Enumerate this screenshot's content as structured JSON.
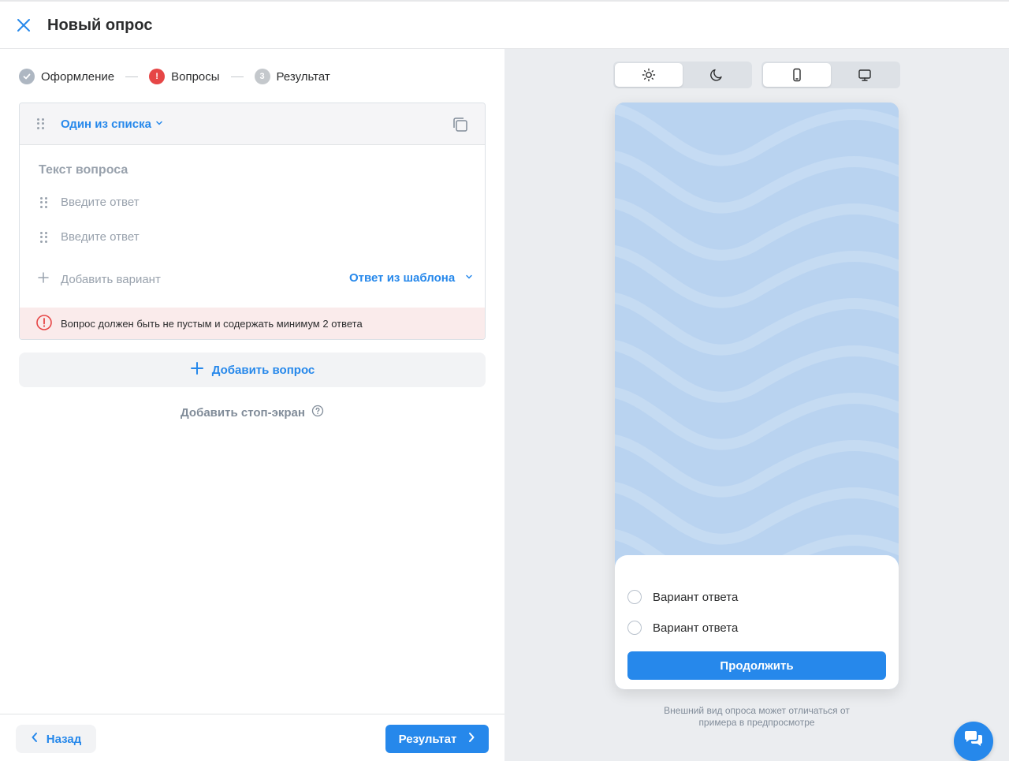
{
  "header": {
    "title": "Новый опрос"
  },
  "steps": [
    {
      "label": "Оформление",
      "state": "done"
    },
    {
      "label": "Вопросы",
      "state": "error",
      "marker": "!"
    },
    {
      "label": "Результат",
      "state": "pending",
      "marker": "3"
    }
  ],
  "question": {
    "type_label": "Один из списка",
    "text_placeholder": "Текст вопроса",
    "answers": [
      {
        "placeholder": "Введите ответ"
      },
      {
        "placeholder": "Введите ответ"
      }
    ],
    "add_variant_label": "Добавить вариант",
    "template_label": "Ответ из шаблона",
    "error_text": "Вопрос должен быть не пустым и содержать минимум 2 ответа"
  },
  "actions": {
    "add_question_label": "Добавить вопрос",
    "stop_screen_label": "Добавить стоп-экран"
  },
  "footer": {
    "back_label": "Назад",
    "next_label": "Результат"
  },
  "preview": {
    "theme_options": [
      "light-theme-icon",
      "dark-theme-icon"
    ],
    "device_options": [
      "mobile-icon",
      "desktop-icon"
    ],
    "options": [
      "Вариант ответа",
      "Вариант ответа"
    ],
    "continue_label": "Продолжить",
    "note_line1": "Внешний вид опроса может отличаться от",
    "note_line2": "примера в предпросмотре"
  },
  "colors": {
    "accent": "#2688eb",
    "error": "#e64646",
    "error_bg": "#faebeb",
    "preview_bg": "#b9d3f0",
    "panel_bg": "#ebedf0"
  }
}
